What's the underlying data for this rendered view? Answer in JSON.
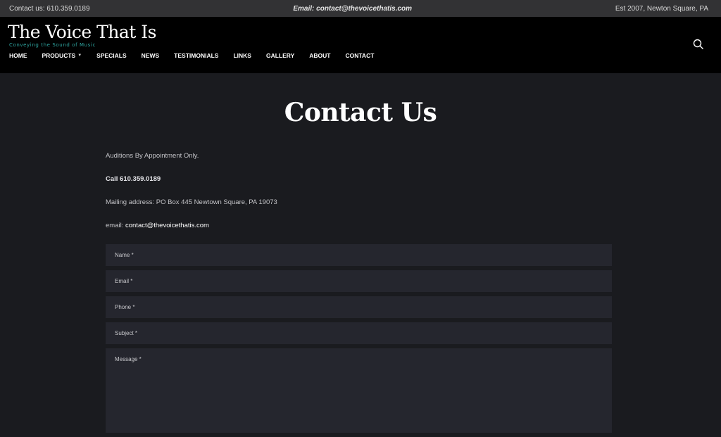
{
  "topbar": {
    "contact": "Contact us: 610.359.0189",
    "email": "Email: contact@thevoicethatis.com",
    "established": "Est  2007, Newton Square, PA"
  },
  "logo": {
    "main": "The Voice That Is",
    "tagline": "Conveying the Sound of Music"
  },
  "nav": {
    "items": [
      {
        "label": "HOME"
      },
      {
        "label": "PRODUCTS"
      },
      {
        "label": "SPECIALS"
      },
      {
        "label": "NEWS"
      },
      {
        "label": "TESTIMONIALS"
      },
      {
        "label": "LINKS"
      },
      {
        "label": "GALLERY"
      },
      {
        "label": "ABOUT"
      },
      {
        "label": "CONTACT"
      }
    ],
    "products_caret": "▼"
  },
  "page": {
    "title": "Contact Us",
    "auditions": "Auditions By Appointment Only.",
    "call": "Call 610.359.0189",
    "mailing": "Mailing address: PO Box 445 Newtown Square, PA 19073",
    "email_prefix": "email: ",
    "email_link": "contact@thevoicethatis.com"
  },
  "form": {
    "name_label": "Name *",
    "email_label": "Email *",
    "phone_label": "Phone *",
    "subject_label": "Subject *",
    "message_label": "Message *"
  },
  "icons": {
    "search": "search-icon"
  },
  "colors": {
    "topbar_bg": "#323234",
    "header_bg": "#000000",
    "page_bg": "#1a1b1f",
    "field_bg": "#25262e",
    "tagline": "#2fa7a2"
  }
}
